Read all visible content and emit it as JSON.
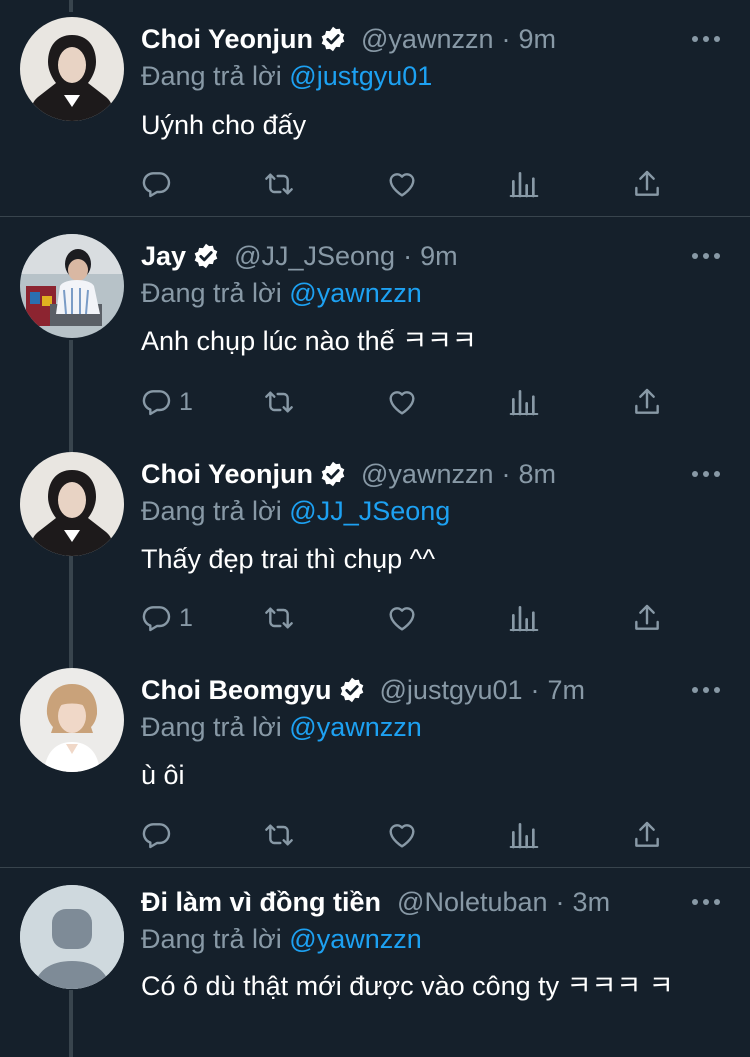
{
  "tweets": [
    {
      "name": "Choi Yeonjun",
      "verified": true,
      "handle": "@yawnzzn",
      "sep": "·",
      "time": "9m",
      "reply_prefix": "Đang trả lời",
      "reply_to": "@justgyu01",
      "text": "Uýnh cho đấy",
      "reply_count": ""
    },
    {
      "name": "Jay",
      "verified": true,
      "handle": "@JJ_JSeong",
      "sep": "·",
      "time": "9m",
      "reply_prefix": "Đang trả lời",
      "reply_to": "@yawnzzn",
      "text": "Anh chụp lúc nào thế ㅋㅋㅋ",
      "reply_count": "1"
    },
    {
      "name": "Choi Yeonjun",
      "verified": true,
      "handle": "@yawnzzn",
      "sep": "·",
      "time": "8m",
      "reply_prefix": "Đang trả lời",
      "reply_to": "@JJ_JSeong",
      "text": "Thấy đẹp trai thì chụp ^^",
      "reply_count": "1"
    },
    {
      "name": "Choi Beomgyu",
      "verified": true,
      "handle": "@justgyu01",
      "sep": "·",
      "time": "7m",
      "reply_prefix": "Đang trả lời",
      "reply_to": "@yawnzzn",
      "text": "ù ôi",
      "reply_count": ""
    },
    {
      "name": "Đi làm vì đồng tiền",
      "verified": false,
      "handle": "@Noletuban",
      "sep": "·",
      "time": "3m",
      "reply_prefix": "Đang trả lời",
      "reply_to": "@yawnzzn",
      "text": "Có ô dù thật mới được vào công ty ㅋㅋㅋ ㅋ",
      "reply_count": ""
    }
  ],
  "icons": {
    "reply": "reply-icon",
    "retweet": "retweet-icon",
    "like": "heart-icon",
    "analytics": "analytics-icon",
    "share": "share-icon",
    "more": "more-icon",
    "verified": "verified-badge-icon"
  },
  "colors": {
    "background": "#15202b",
    "divider": "#38444d",
    "secondary_text": "#8899a6",
    "link": "#1da1f2",
    "primary_text": "#ffffff"
  }
}
